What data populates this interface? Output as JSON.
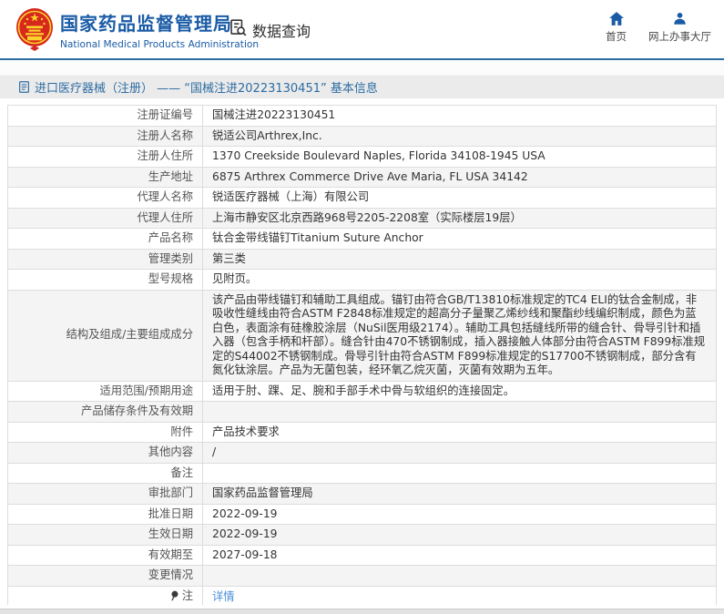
{
  "header": {
    "logo": {
      "emblem_icon": "national-emblem-icon",
      "title": "国家药品监督管理局",
      "subtitle": "National Medical Products Administration"
    },
    "query": {
      "icon": "document-search-icon",
      "label": "数据查询"
    },
    "nav": [
      {
        "icon": "home-icon",
        "label": "首页"
      },
      {
        "icon": "person-icon",
        "label": "网上办事大厅"
      }
    ]
  },
  "breadcrumb": {
    "icon": "document-icon",
    "title": "进口医疗器械（注册） —— “国械注进20223130451” 基本信息"
  },
  "table": {
    "rows": [
      {
        "label": "注册证编号",
        "value": "国械注进20223130451"
      },
      {
        "label": "注册人名称",
        "value": "锐适公司Arthrex,Inc."
      },
      {
        "label": "注册人住所",
        "value": "1370 Creekside Boulevard Naples, Florida 34108-1945 USA"
      },
      {
        "label": "生产地址",
        "value": "6875 Arthrex Commerce Drive Ave Maria, FL USA 34142"
      },
      {
        "label": "代理人名称",
        "value": "锐适医疗器械（上海）有限公司"
      },
      {
        "label": "代理人住所",
        "value": "上海市静安区北京西路968号2205-2208室（实际楼层19层）"
      },
      {
        "label": "产品名称",
        "value": "钛合金带线锚钉Titanium Suture Anchor"
      },
      {
        "label": "管理类别",
        "value": "第三类"
      },
      {
        "label": "型号规格",
        "value": "见附页。"
      },
      {
        "label": "结构及组成/主要组成成分",
        "value": "该产品由带线锚钉和辅助工具组成。锚钉由符合GB/T13810标准规定的TC4 ELI的钛合金制成，非吸收性缝线由符合ASTM F2848标准规定的超高分子量聚乙烯纱线和聚酯纱线编织制成，颜色为蓝白色，表面涂有硅橡胶涂层（NuSil医用级2174）。辅助工具包括缝线所带的缝合针、骨导引针和插入器（包含手柄和杆部）。缝合针由470不锈钢制成，插入器接触人体部分由符合ASTM F899标准规定的S44002不锈钢制成。骨导引针由符合ASTM F899标准规定的S17700不锈钢制成，部分含有氮化钛涂层。产品为无菌包装，经环氧乙烷灭菌，灭菌有效期为五年。"
      },
      {
        "label": "适用范围/预期用途",
        "value": "适用于肘、踝、足、腕和手部手术中骨与软组织的连接固定。"
      },
      {
        "label": "产品储存条件及有效期",
        "value": ""
      },
      {
        "label": "附件",
        "value": "产品技术要求"
      },
      {
        "label": "其他内容",
        "value": "/"
      },
      {
        "label": "备注",
        "value": ""
      },
      {
        "label": "审批部门",
        "value": "国家药品监督管理局"
      },
      {
        "label": "批准日期",
        "value": "2022-09-19"
      },
      {
        "label": "生效日期",
        "value": "2022-09-19"
      },
      {
        "label": "有效期至",
        "value": "2027-09-18"
      },
      {
        "label": "变更情况",
        "value": ""
      },
      {
        "label": "注",
        "label_icon": "note-pin-icon",
        "value": "详情",
        "value_is_link": true
      }
    ]
  },
  "colors": {
    "brand_blue": "#1a5ba6",
    "divider_blue": "#2e6da4",
    "breadcrumb_blue": "#2d6ca2",
    "link_blue": "#4a90d9",
    "emblem_red": "#d7281d",
    "emblem_gold": "#fbd12b",
    "alt_row_gray": "#f4f4f4"
  }
}
